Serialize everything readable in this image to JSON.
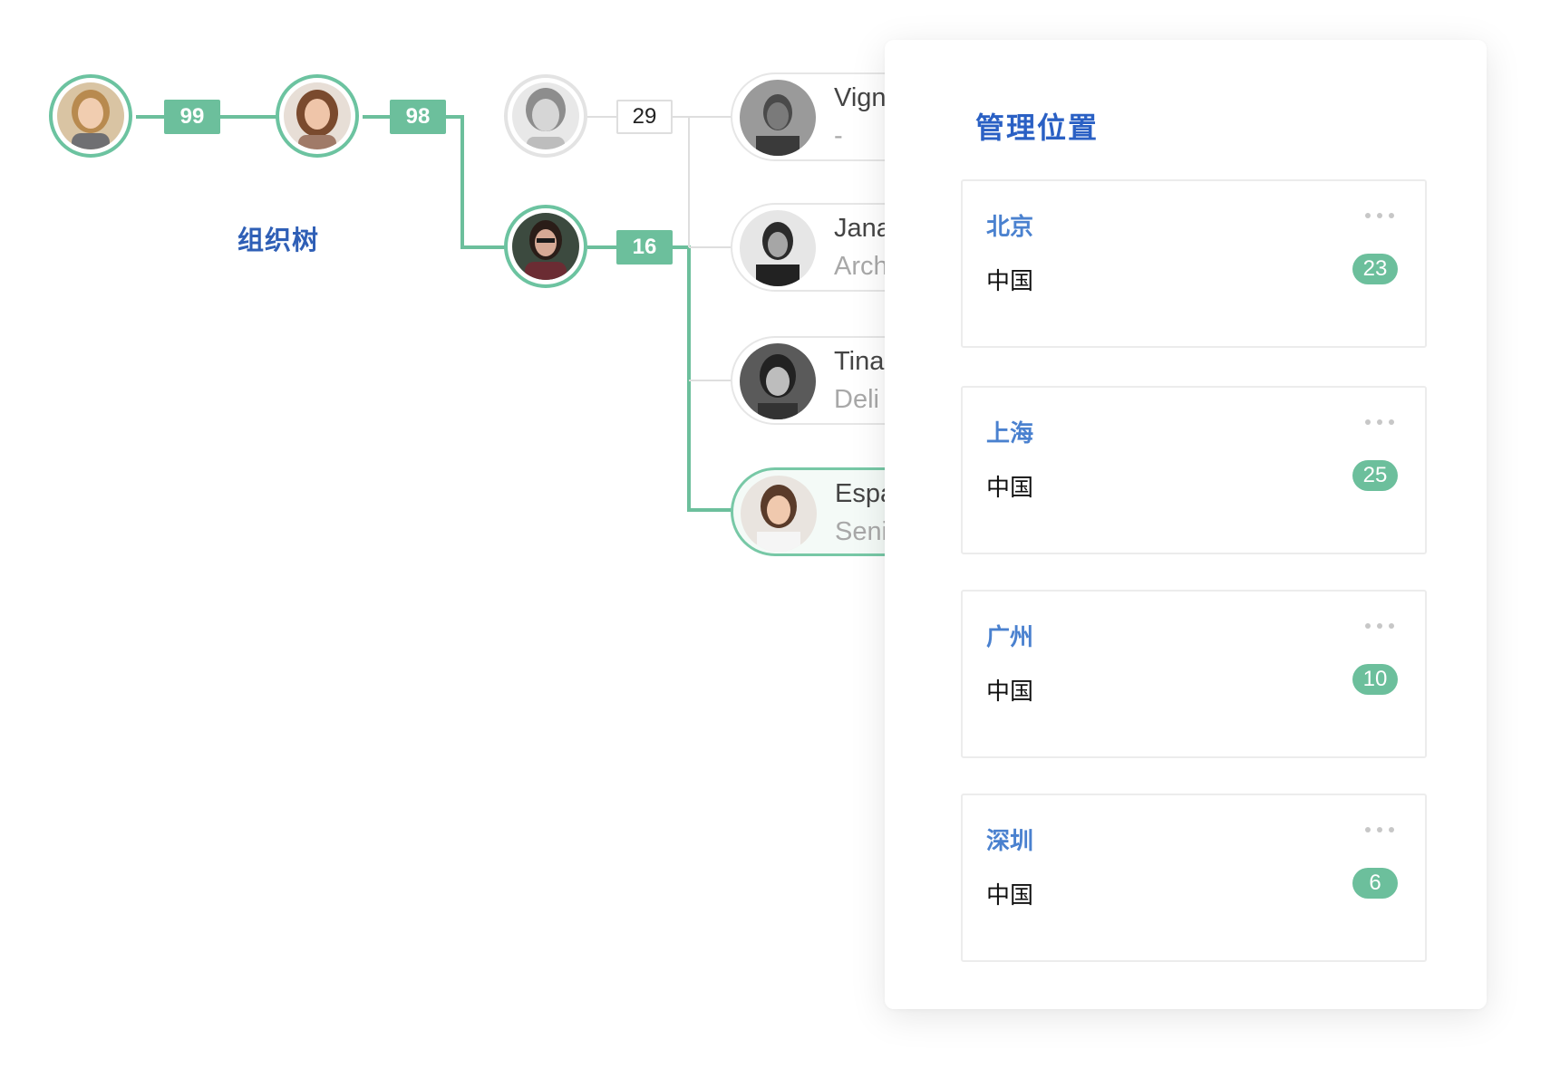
{
  "tree": {
    "title": "组织树",
    "chain": [
      {
        "badge": "99"
      },
      {
        "badge": "98"
      },
      {
        "badge": "29"
      },
      {
        "badge": "16"
      }
    ],
    "people": [
      {
        "name": "Vign",
        "role": "-"
      },
      {
        "name": "Jana",
        "role": "Arch"
      },
      {
        "name": "Tina",
        "role": "Deli"
      },
      {
        "name": "Espa",
        "role": "Seni"
      }
    ]
  },
  "panel": {
    "title": "管理位置",
    "locations": [
      {
        "city": "北京",
        "country": "中国",
        "count": "23"
      },
      {
        "city": "上海",
        "country": "中国",
        "count": "25"
      },
      {
        "city": "广州",
        "country": "中国",
        "count": "10"
      },
      {
        "city": "深圳",
        "country": "中国",
        "count": "6"
      }
    ]
  },
  "colors": {
    "accent_green": "#6cbf9c",
    "title_blue": "#2a60c4",
    "city_blue": "#4a81cf"
  }
}
